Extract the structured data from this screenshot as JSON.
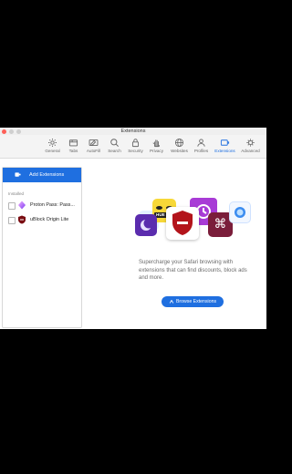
{
  "window": {
    "title": "Extensions"
  },
  "toolbar": {
    "items": [
      {
        "label": "General",
        "icon": "gear-icon"
      },
      {
        "label": "Tabs",
        "icon": "tabs-icon"
      },
      {
        "label": "AutoFill",
        "icon": "autofill-icon"
      },
      {
        "label": "Search",
        "icon": "search-icon"
      },
      {
        "label": "Security",
        "icon": "lock-icon"
      },
      {
        "label": "Privacy",
        "icon": "hand-icon"
      },
      {
        "label": "Websites",
        "icon": "globe-icon"
      },
      {
        "label": "Profiles",
        "icon": "person-icon"
      },
      {
        "label": "Extensions",
        "icon": "extensions-icon",
        "active": true
      },
      {
        "label": "Advanced",
        "icon": "gear-advanced-icon"
      }
    ]
  },
  "sidebar": {
    "add_label": "Add Extensions",
    "section_label": "Installed",
    "extensions": [
      {
        "name": "Proton Pass: Pass...",
        "icon": "proton-pass-icon",
        "enabled": false
      },
      {
        "name": "uBlock Origin Lite",
        "icon": "ublock-icon",
        "enabled": false
      }
    ]
  },
  "main": {
    "promo_text": "Supercharge your Safari browsing with extensions that can find discounts, block ads and more.",
    "browse_label": "Browse Extensions",
    "hero_badge_text": "HUE"
  },
  "colors": {
    "accent": "#1f6fe0",
    "close_button": "#fe5f57",
    "shield": "#b3141b"
  }
}
